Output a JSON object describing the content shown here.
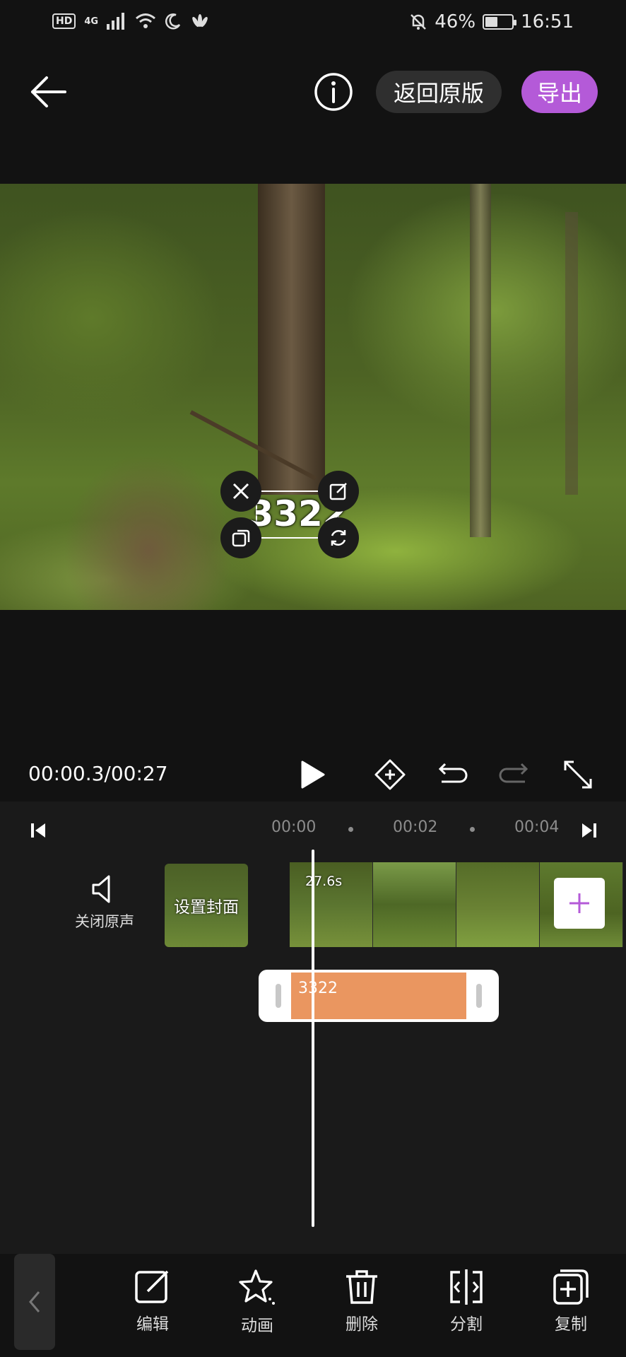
{
  "status_bar": {
    "hd": "HD",
    "network": "4G",
    "battery": "46%",
    "battery_level": 0.46,
    "time": "16:51"
  },
  "header": {
    "revert_label": "返回原版",
    "export_label": "导出"
  },
  "preview": {
    "sticker_text": "3322"
  },
  "playback": {
    "time": "00:00.3/00:27"
  },
  "timeline": {
    "ruler": [
      "00:00",
      "00:02",
      "00:04"
    ],
    "mute_label": "关闭原声",
    "cover_label": "设置封面",
    "clip_duration": "27.6s",
    "sticker_clip_label": "3322"
  },
  "toolbar": {
    "items": [
      {
        "label": "编辑",
        "icon": "edit-icon"
      },
      {
        "label": "动画",
        "icon": "animation-icon"
      },
      {
        "label": "删除",
        "icon": "delete-icon"
      },
      {
        "label": "分割",
        "icon": "split-icon"
      },
      {
        "label": "复制",
        "icon": "copy-icon"
      }
    ]
  },
  "colors": {
    "accent": "#b45ad8",
    "sticker_clip": "#ea9660",
    "background": "#121212"
  }
}
